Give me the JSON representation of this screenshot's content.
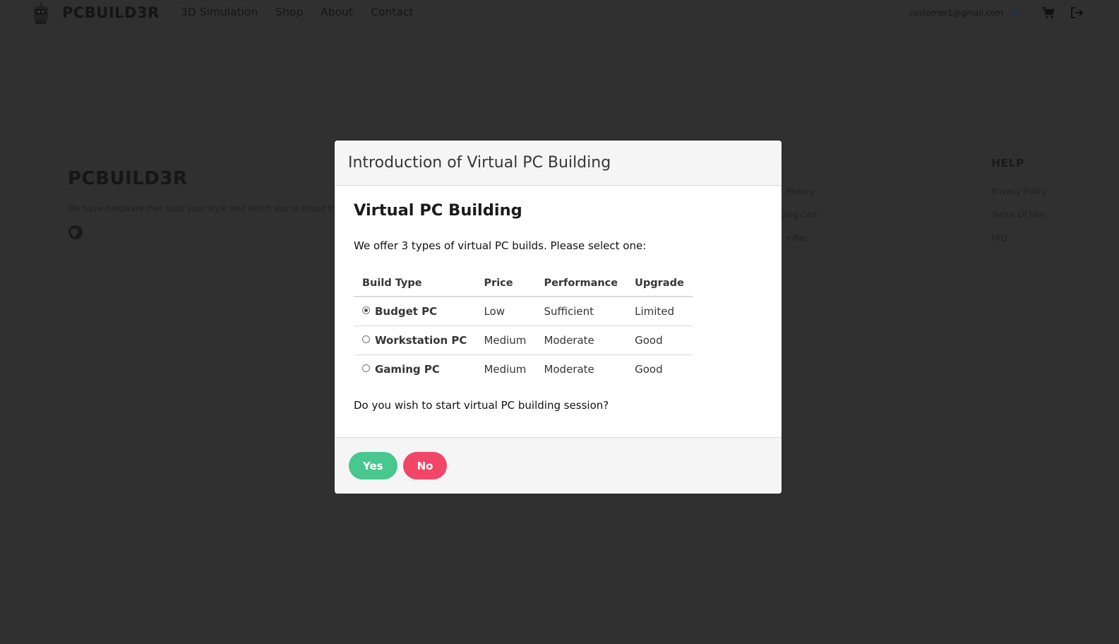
{
  "nav": {
    "brand": "PCBUILD3R",
    "links": [
      "3D Simulation",
      "Shop",
      "About",
      "Contact"
    ],
    "user_email": "customer1@gmail.com"
  },
  "footer": {
    "brand": "PCBUILD3R",
    "tagline": "We have hardware that suits your style and which you're proud to",
    "account_heading": "OUNT",
    "account_links": [
      "History",
      "ping Cart",
      "rofile"
    ],
    "help_heading": "HELP",
    "help_links": [
      "Privacy Policy",
      "Terms Of Use",
      "FAQ"
    ]
  },
  "modal": {
    "title": "Introduction of Virtual PC Building",
    "heading": "Virtual PC Building",
    "intro": "We offer 3 types of virtual PC builds. Please select one:",
    "columns": [
      "Build Type",
      "Price",
      "Performance",
      "Upgrade"
    ],
    "rows": [
      {
        "type": "Budget PC",
        "price": "Low",
        "performance": "Sufficient",
        "upgrade": "Limited",
        "selected": true
      },
      {
        "type": "Workstation PC",
        "price": "Medium",
        "performance": "Moderate",
        "upgrade": "Good",
        "selected": false
      },
      {
        "type": "Gaming PC",
        "price": "Medium",
        "performance": "Moderate",
        "upgrade": "Good",
        "selected": false
      }
    ],
    "question": "Do you wish to start virtual PC building session?",
    "yes_label": "Yes",
    "no_label": "No"
  },
  "colors": {
    "background": "#303030",
    "yes": "#48c78e",
    "no": "#f14668"
  }
}
